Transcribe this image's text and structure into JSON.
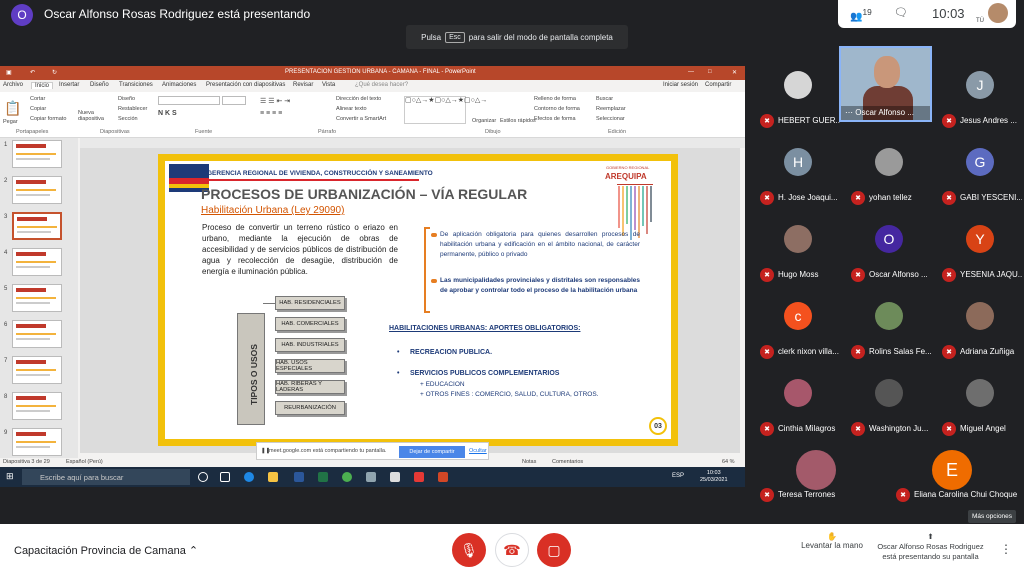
{
  "presenter": {
    "initial": "O",
    "banner": "Oscar Alfonso Rosas Rodriguez está presentando"
  },
  "top_right": {
    "participants_count": "19",
    "time": "10:03",
    "me_label": "TÚ"
  },
  "fullscreen_toast": {
    "prefix": "Pulsa",
    "key": "Esc",
    "suffix": "para salir del modo de pantalla completa"
  },
  "ppt": {
    "doc_title": "PRESENTACION GESTION URBANA - CAMANA - FINAL - PowerPoint",
    "tabs": [
      "Archivo",
      "Inicio",
      "Insertar",
      "Diseño",
      "Transiciones",
      "Animaciones",
      "Presentación con diapositivas",
      "Revisar",
      "Vista",
      "¿Qué desea hacer?"
    ],
    "signin": "Iniciar sesión",
    "share": "Compartir",
    "ribbon": {
      "paste": "Pegar",
      "cut": "Cortar",
      "copy": "Copiar",
      "copy_format": "Copiar formato",
      "new_slide": "Nueva diapositiva",
      "layout": "Diseño",
      "reset": "Restablecer",
      "section": "Sección",
      "text_dir": "Dirección del texto",
      "align_text": "Alinear texto",
      "smartart": "Convertir a SmartArt",
      "organize": "Organizar",
      "quick_styles": "Estilos rápidos",
      "shape_fill": "Relleno de forma",
      "shape_outline": "Contorno de forma",
      "shape_effects": "Efectos de forma",
      "find": "Buscar",
      "replace": "Reemplazar",
      "select": "Seleccionar",
      "groups": [
        "Portapapeles",
        "Diapositivas",
        "Fuente",
        "Párrafo",
        "Dibujo",
        "Edición"
      ]
    },
    "slide_numbers": [
      "1",
      "2",
      "3",
      "4",
      "5",
      "6",
      "7",
      "8",
      "9"
    ],
    "status": {
      "slide_of": "Diapositiva 3 de 29",
      "lang": "Español (Perú)",
      "notes": "Notas",
      "comments": "Comentarios",
      "zoom": "64 %"
    }
  },
  "slide": {
    "header": "GERENCIA REGIONAL DE VIVIENDA, CONSTRUCCIÓN Y SANEAMIENTO",
    "gob_label": "GOBIERNO REGIONAL",
    "region": "AREQUIPA",
    "title": "PROCESOS DE URBANIZACIÓN – VÍA REGULAR",
    "subtitle": "Habilitación Urbana (Ley 29090)",
    "body": "Proceso de convertir un terreno rústico o eriazo en urbano, mediante la ejecución de obras de accesibilidad y de servicios públicos de distribución de agua y recolección de desagüe, distribución de energía e iluminación pública.",
    "bullet1": "De aplicación obligatoria para quienes desarrollen procesos de habilitación urbana y edificación en el ámbito nacional, de carácter permanente, público o privado",
    "bullet2": "Las municipalidades provinciales y distritales son responsables de aprobar y controlar todo el proceso de la habilitación urbana",
    "tipos_label": "TIPOS O USOS",
    "hab_types": [
      "HAB. RESIDENCIALES",
      "HAB. COMERCIALES",
      "HAB. INDUSTRIALES",
      "HAB. USOS ESPECIALES",
      "HAB. RIBERAS Y LADERAS",
      "REURBANIZACIÓN"
    ],
    "aportes_title": "HABILITACIONES URBANAS: APORTES OBLIGATORIOS:",
    "aporte1": "RECREACION PUBLICA.",
    "aporte2": "SERVICIOS PUBLICOS COMPLEMENTARIOS",
    "aporte2_sub1": "+ EDUCACION",
    "aporte2_sub2": "+ OTROS FINES : COMERCIO, SALUD, CULTURA, OTROS.",
    "page": "03"
  },
  "share_bar": {
    "text": "meet.google.com está compartiendo tu pantalla.",
    "stop": "Dejar de compartir",
    "hide": "Ocultar"
  },
  "taskbar": {
    "search": "Escribe aquí para buscar",
    "lang": "ESP",
    "time": "10:03",
    "date": "25/03/2021"
  },
  "participants": [
    {
      "name": "HEBERT GUER...",
      "initial": "",
      "color": "#d6d6d6"
    },
    {
      "name": "Jesus Andres ...",
      "initial": "J",
      "color": "#8a9aa8"
    },
    {
      "name": "H. Jose Joaqui...",
      "initial": "H",
      "color": "#7b8fa1"
    },
    {
      "name": "yohan tellez",
      "initial": "",
      "color": "#9a9a9a"
    },
    {
      "name": "GABI YESCENI...",
      "initial": "G",
      "color": "#5c6bc0"
    },
    {
      "name": "Hugo Moss",
      "initial": "",
      "color": "#8d6e63"
    },
    {
      "name": "Oscar Alfonso ...",
      "initial": "O",
      "color": "#4527a0"
    },
    {
      "name": "YESENIA JAQU...",
      "initial": "Y",
      "color": "#d84315"
    },
    {
      "name": "clerk nixon villa...",
      "initial": "c",
      "color": "#f4511e"
    },
    {
      "name": "Rolins Salas Fe...",
      "initial": "",
      "color": "#6d8b5a"
    },
    {
      "name": "Adriana Zuñiga",
      "initial": "",
      "color": "#8c6a5a"
    },
    {
      "name": "Cinthia Milagros",
      "initial": "",
      "color": "#a7576b"
    },
    {
      "name": "Washington Ju...",
      "initial": "",
      "color": "#555"
    },
    {
      "name": "Miguel Angel",
      "initial": "",
      "color": "#6e6e6e"
    },
    {
      "name": "Teresa Terrones",
      "initial": "",
      "color": "#a35a6a"
    },
    {
      "name": "Eliana Carolina Chui Choque",
      "initial": "E",
      "color": "#ef6c00"
    }
  ],
  "active_speaker": {
    "name": "Oscar Alfonso ..."
  },
  "more_options": "Más opciones",
  "bottom": {
    "meeting_name": "Capacitación Provincia de Camana",
    "raise_hand": "Levantar la mano",
    "presenting_info": "Oscar Alfonso Rosas Rodriguez está presentando su pantalla"
  },
  "colors": {
    "mic_off": "#c5221f",
    "slide_border": "#f2c10b",
    "ppt_brand": "#b7472a"
  }
}
